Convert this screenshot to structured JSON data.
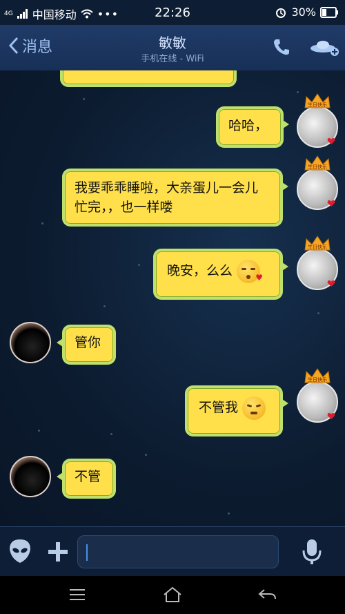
{
  "status_bar": {
    "network": "4G",
    "carrier": "中国移动",
    "time": "22:26",
    "battery": "30%"
  },
  "nav": {
    "back_label": "消息",
    "contact_name": "敏敏",
    "contact_status": "手机在线 - WiFi"
  },
  "messages": [
    {
      "from": "me",
      "text": "哈哈，"
    },
    {
      "from": "me",
      "text": "我要乖乖睡啦，大亲蛋儿一会儿忙完，，也一样喽"
    },
    {
      "from": "me",
      "text": "晚安，么么"
    },
    {
      "from": "her",
      "text": "管你"
    },
    {
      "from": "me",
      "text": "不管我"
    },
    {
      "from": "her",
      "text": "不管"
    }
  ],
  "avatar_badge_text": "生日快乐",
  "colors": {
    "bubble_fill": "#ffe04a",
    "bubble_border": "#bfe06a",
    "nav_bg": "#1b345d",
    "chat_bg": "#0d1e33"
  }
}
